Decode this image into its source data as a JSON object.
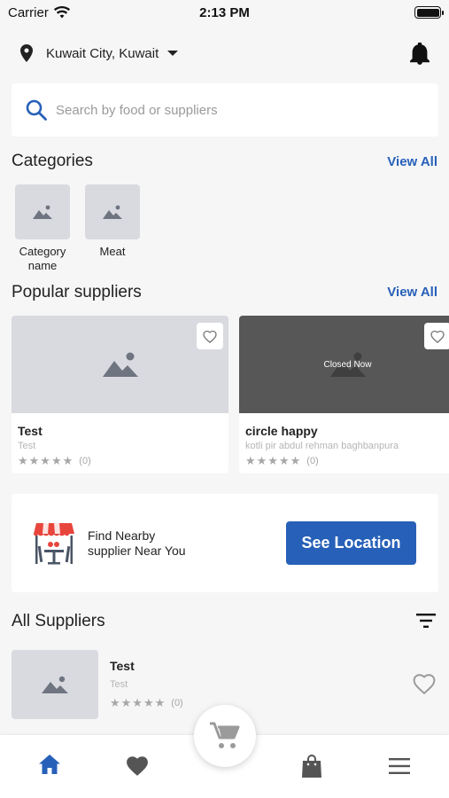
{
  "status_bar": {
    "carrier": "Carrier",
    "time": "2:13 PM"
  },
  "location": {
    "text": "Kuwait City, Kuwait"
  },
  "search": {
    "placeholder": "Search by food or suppliers"
  },
  "categories": {
    "title": "Categories",
    "view_all": "View All",
    "items": [
      {
        "label": "Category name"
      },
      {
        "label": "Meat"
      }
    ]
  },
  "popular": {
    "title": "Popular suppliers",
    "view_all": "View All",
    "items": [
      {
        "name": "Test",
        "subtitle": "Test",
        "rating_count": "(0)",
        "closed": false
      },
      {
        "name": "circle happy",
        "subtitle": "kotli pir abdul rehman baghbanpura",
        "rating_count": "(0)",
        "closed": true,
        "closed_label": "Closed Now"
      }
    ]
  },
  "promo": {
    "text_line1": "Find Nearby",
    "text_line2": "supplier Near You",
    "button_label": "See Location"
  },
  "all_suppliers": {
    "title": "All Suppliers",
    "items": [
      {
        "name": "Test",
        "subtitle": "Test",
        "rating_count": "(0)"
      }
    ]
  },
  "stars": "★★★★★",
  "colors": {
    "accent": "#2760b8",
    "placeholder_bg": "#d8dadf",
    "closed_overlay": "#575757",
    "icon_gray": "#555555"
  },
  "icons": {
    "status": [
      "wifi-icon",
      "battery-icon"
    ],
    "header": [
      "location-pin-icon",
      "chevron-down-icon",
      "bell-icon"
    ],
    "search": "search-icon",
    "tabbar": [
      "home-icon",
      "heart-icon",
      "cart-icon",
      "bag-icon",
      "menu-icon"
    ]
  }
}
